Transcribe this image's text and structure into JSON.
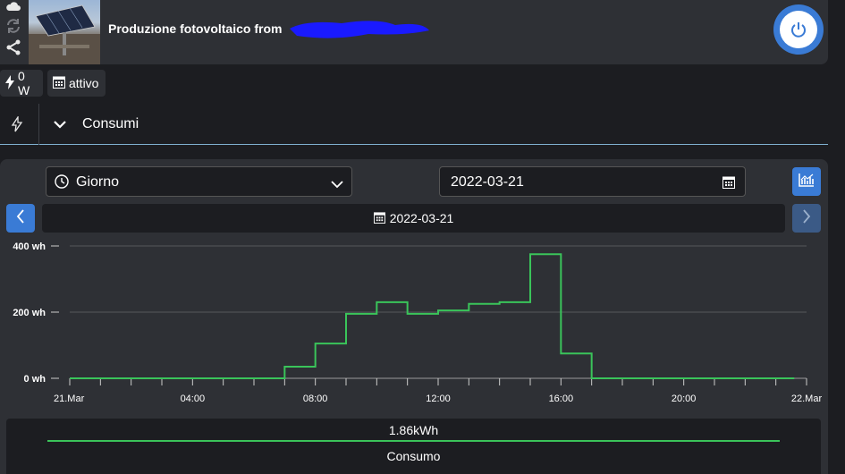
{
  "device": {
    "title": "Produzione fotovoltaico from"
  },
  "status": {
    "power": "0 W",
    "schedule": "attivo"
  },
  "section": {
    "label": "Consumi"
  },
  "controls": {
    "period_select": "Giorno",
    "date_value": "2022-03-21",
    "date_bar": "2022-03-21"
  },
  "chart_data": {
    "type": "line",
    "step": true,
    "unit": "wh",
    "ylim": [
      0,
      400
    ],
    "y_ticks": [
      "0 wh",
      "200 wh",
      "400 wh"
    ],
    "x_ticks": [
      "21.Mar",
      "04:00",
      "08:00",
      "12:00",
      "16:00",
      "20:00",
      "22.Mar"
    ],
    "x": [
      "00:00",
      "01:00",
      "02:00",
      "03:00",
      "04:00",
      "05:00",
      "06:00",
      "07:00",
      "08:00",
      "09:00",
      "10:00",
      "11:00",
      "12:00",
      "13:00",
      "14:00",
      "15:00",
      "16:00",
      "17:00",
      "18:00",
      "19:00",
      "20:00",
      "21:00",
      "22:00",
      "23:00"
    ],
    "series": [
      {
        "values": [
          0,
          0,
          0,
          0,
          0,
          0,
          0,
          35,
          105,
          195,
          230,
          195,
          205,
          225,
          230,
          375,
          75,
          0,
          0,
          0,
          0,
          0,
          0,
          0
        ],
        "color": "#3ac45a"
      }
    ],
    "grid": true
  },
  "summary": {
    "total": "1.86kWh",
    "series_name": "Consumo",
    "color": "#3ac45a"
  },
  "icons": {
    "cloud": "cloud-icon",
    "sync": "sync-icon",
    "share": "share-icon",
    "power": "power-icon",
    "bolt": "bolt-icon",
    "calendar": "calendar-icon",
    "clock": "clock-icon",
    "chevron": "chevron-down-icon"
  }
}
